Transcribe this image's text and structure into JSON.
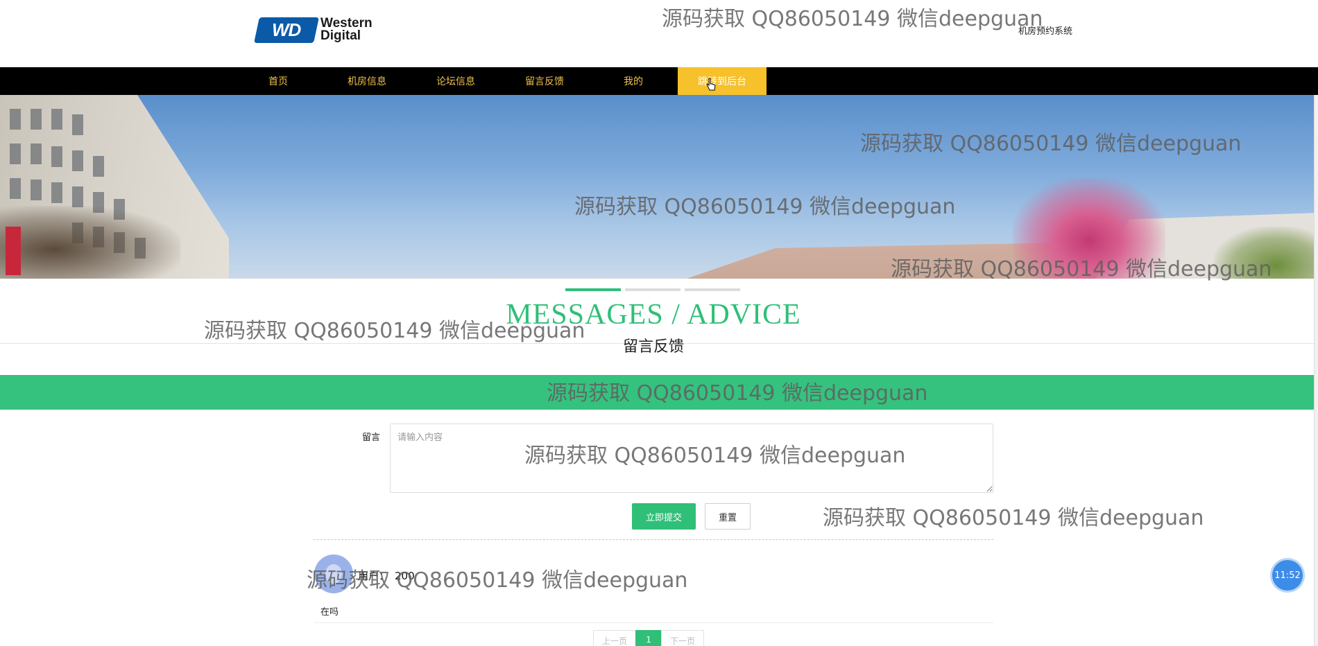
{
  "header": {
    "logo_word_1": "Western",
    "logo_word_2": "Digital",
    "logo_badge": "WD",
    "system_name": "机房预约系统"
  },
  "nav": {
    "items": [
      {
        "label": "首页"
      },
      {
        "label": "机房信息"
      },
      {
        "label": "论坛信息"
      },
      {
        "label": "留言反馈"
      },
      {
        "label": "我的"
      },
      {
        "label": "跳转到后台"
      }
    ],
    "active_index": 5
  },
  "banner": {
    "slides": 3,
    "active_slide": 0
  },
  "section": {
    "title_en": "MESSAGES / ADVICE",
    "title_cn": "留言反馈"
  },
  "form": {
    "label": "留言",
    "placeholder": "请输入内容",
    "submit_label": "立即提交",
    "reset_label": "重置"
  },
  "comments": [
    {
      "user_label": "用户：",
      "user_value": "200",
      "text": "在吗"
    }
  ],
  "pagination": {
    "prev": "上一页",
    "current": "1",
    "next": "下一页"
  },
  "floating": {
    "time": "11:52"
  },
  "watermark": "源码获取 QQ86050149 微信deepguan",
  "colors": {
    "accent_green": "#2fbf78",
    "nav_bg": "#000000",
    "nav_text": "#f0c14b",
    "nav_active_bg": "#f6c12a"
  }
}
